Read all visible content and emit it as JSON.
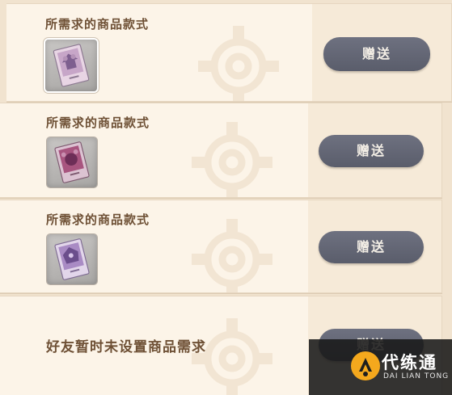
{
  "requests": [
    {
      "title": "所需求的商品款式",
      "button_label": "赠送",
      "item_icon": "purple-pattern-card-icon",
      "item_tint": "#c7a6c8"
    },
    {
      "title": "所需求的商品款式",
      "button_label": "赠送",
      "item_icon": "magenta-pattern-card-icon",
      "item_tint": "#a8557f"
    },
    {
      "title": "所需求的商品款式",
      "button_label": "赠送",
      "item_icon": "violet-pattern-card-icon",
      "item_tint": "#a98bc4"
    }
  ],
  "empty_request": {
    "text": "好友暂时未设置商品需求",
    "button_label": "赠送"
  },
  "watermark": {
    "name": "代练通",
    "sub": "DAI LIAN TONG"
  },
  "colors": {
    "card_bg": "#fcf4e8",
    "panel_bg": "#f6ead8",
    "title_text": "#6e5035",
    "button_bg": "#5f6270",
    "button_text": "#f4efe6"
  }
}
